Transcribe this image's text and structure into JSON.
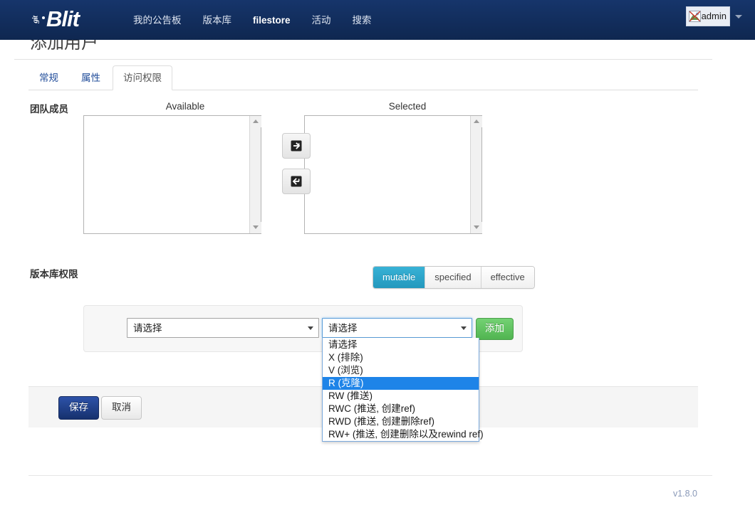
{
  "navbar": {
    "brand": {
      "git": "git",
      "blit": "Blit"
    },
    "links": [
      {
        "label": "我的公告板",
        "active": false
      },
      {
        "label": "版本库",
        "active": false
      },
      {
        "label": "filestore",
        "active": true
      },
      {
        "label": "活动",
        "active": false
      },
      {
        "label": "搜索",
        "active": false
      }
    ],
    "user": {
      "name": "admin",
      "avatar_icon": "broken-image-icon",
      "caret_icon": "chevron-down-icon"
    }
  },
  "page": {
    "title": "添加用户"
  },
  "tabs": [
    {
      "label": "常规",
      "active": false
    },
    {
      "label": "属性",
      "active": false
    },
    {
      "label": "访问权限",
      "active": true
    }
  ],
  "team_members": {
    "label": "团队成员",
    "available_header": "Available",
    "selected_header": "Selected",
    "available_items": [],
    "selected_items": [],
    "transfer_right_icon": "arrow-right-into-box-icon",
    "transfer_left_icon": "arrow-left-into-box-icon"
  },
  "repo_permissions": {
    "label": "版本库权限",
    "modes": [
      {
        "label": "mutable",
        "active": true
      },
      {
        "label": "specified",
        "active": false
      },
      {
        "label": "effective",
        "active": false
      }
    ],
    "active_color": "#2ba6cb",
    "repo_select": {
      "value": "请选择"
    },
    "perm_select": {
      "value": "请选择",
      "focused": true
    },
    "add_button": "添加",
    "dropdown_options": [
      {
        "label": "请选择",
        "selected": false
      },
      {
        "label": "X (排除)",
        "selected": false
      },
      {
        "label": "V (浏览)",
        "selected": false
      },
      {
        "label": "R (克隆)",
        "selected": true
      },
      {
        "label": "RW (推送)",
        "selected": false
      },
      {
        "label": "RWC (推送, 创建ref)",
        "selected": false
      },
      {
        "label": "RWD (推送, 创建删除ref)",
        "selected": false
      },
      {
        "label": "RW+ (推送, 创建删除以及rewind ref)",
        "selected": false
      }
    ],
    "dropdown_highlight_color": "#1e84e8"
  },
  "form_actions": {
    "save_label": "保存",
    "cancel_label": "取消",
    "save_color": "#1f3f87"
  },
  "footer": {
    "version": "v1.8.0"
  }
}
